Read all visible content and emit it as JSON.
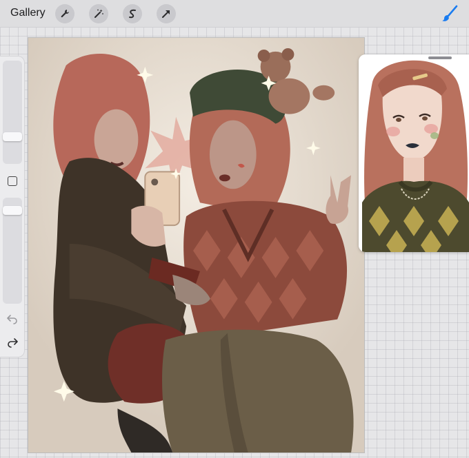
{
  "toolbar": {
    "gallery_label": "Gallery",
    "tools": [
      {
        "name": "wrench-icon"
      },
      {
        "name": "magic-wand-icon"
      },
      {
        "name": "selection-icon"
      },
      {
        "name": "transform-arrow-icon"
      }
    ],
    "active_tool_icon": "brush-icon",
    "accent": "#1a7cf0"
  },
  "sidebar": {
    "items": [
      "brush-size-slider",
      "modify-button",
      "opacity-slider",
      "undo-icon",
      "redo-icon"
    ]
  },
  "canvas": {
    "artwork": "illustration"
  },
  "reference_window": {
    "artwork": "portrait"
  }
}
